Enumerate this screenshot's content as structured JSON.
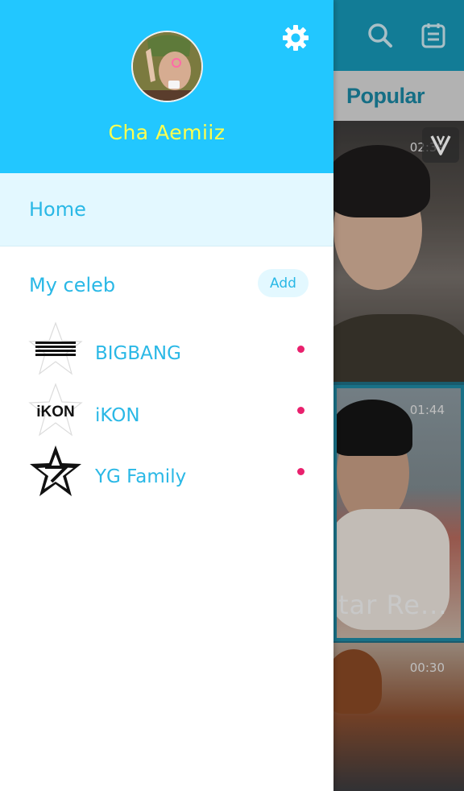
{
  "background": {
    "tab_label": "Popular",
    "cards": [
      {
        "duration": "02:39"
      },
      {
        "duration": "01:44",
        "caption": "tar Re..."
      },
      {
        "duration": "00:30"
      }
    ],
    "icons": {
      "search": "search-icon",
      "calendar": "calendar-icon",
      "badge": "v-logo-icon"
    }
  },
  "drawer": {
    "colors": {
      "header": "#22c7ff",
      "username": "#ffff4e",
      "accent": "#2ab8e6",
      "dot": "#e9206d",
      "home_bg": "#e3f8ff"
    },
    "user": {
      "name": "Cha Aemiiz"
    },
    "settings_icon": "gear-icon",
    "home_label": "Home",
    "my_celeb": {
      "label": "My celeb",
      "add_label": "Add",
      "items": [
        {
          "name": "BIGBANG",
          "logo": "bigbang-logo",
          "new": true
        },
        {
          "name": "iKON",
          "logo": "ikon-logo",
          "logo_text": "iKON",
          "new": true
        },
        {
          "name": "YG Family",
          "logo": "yg-family-logo",
          "new": true
        }
      ]
    }
  }
}
